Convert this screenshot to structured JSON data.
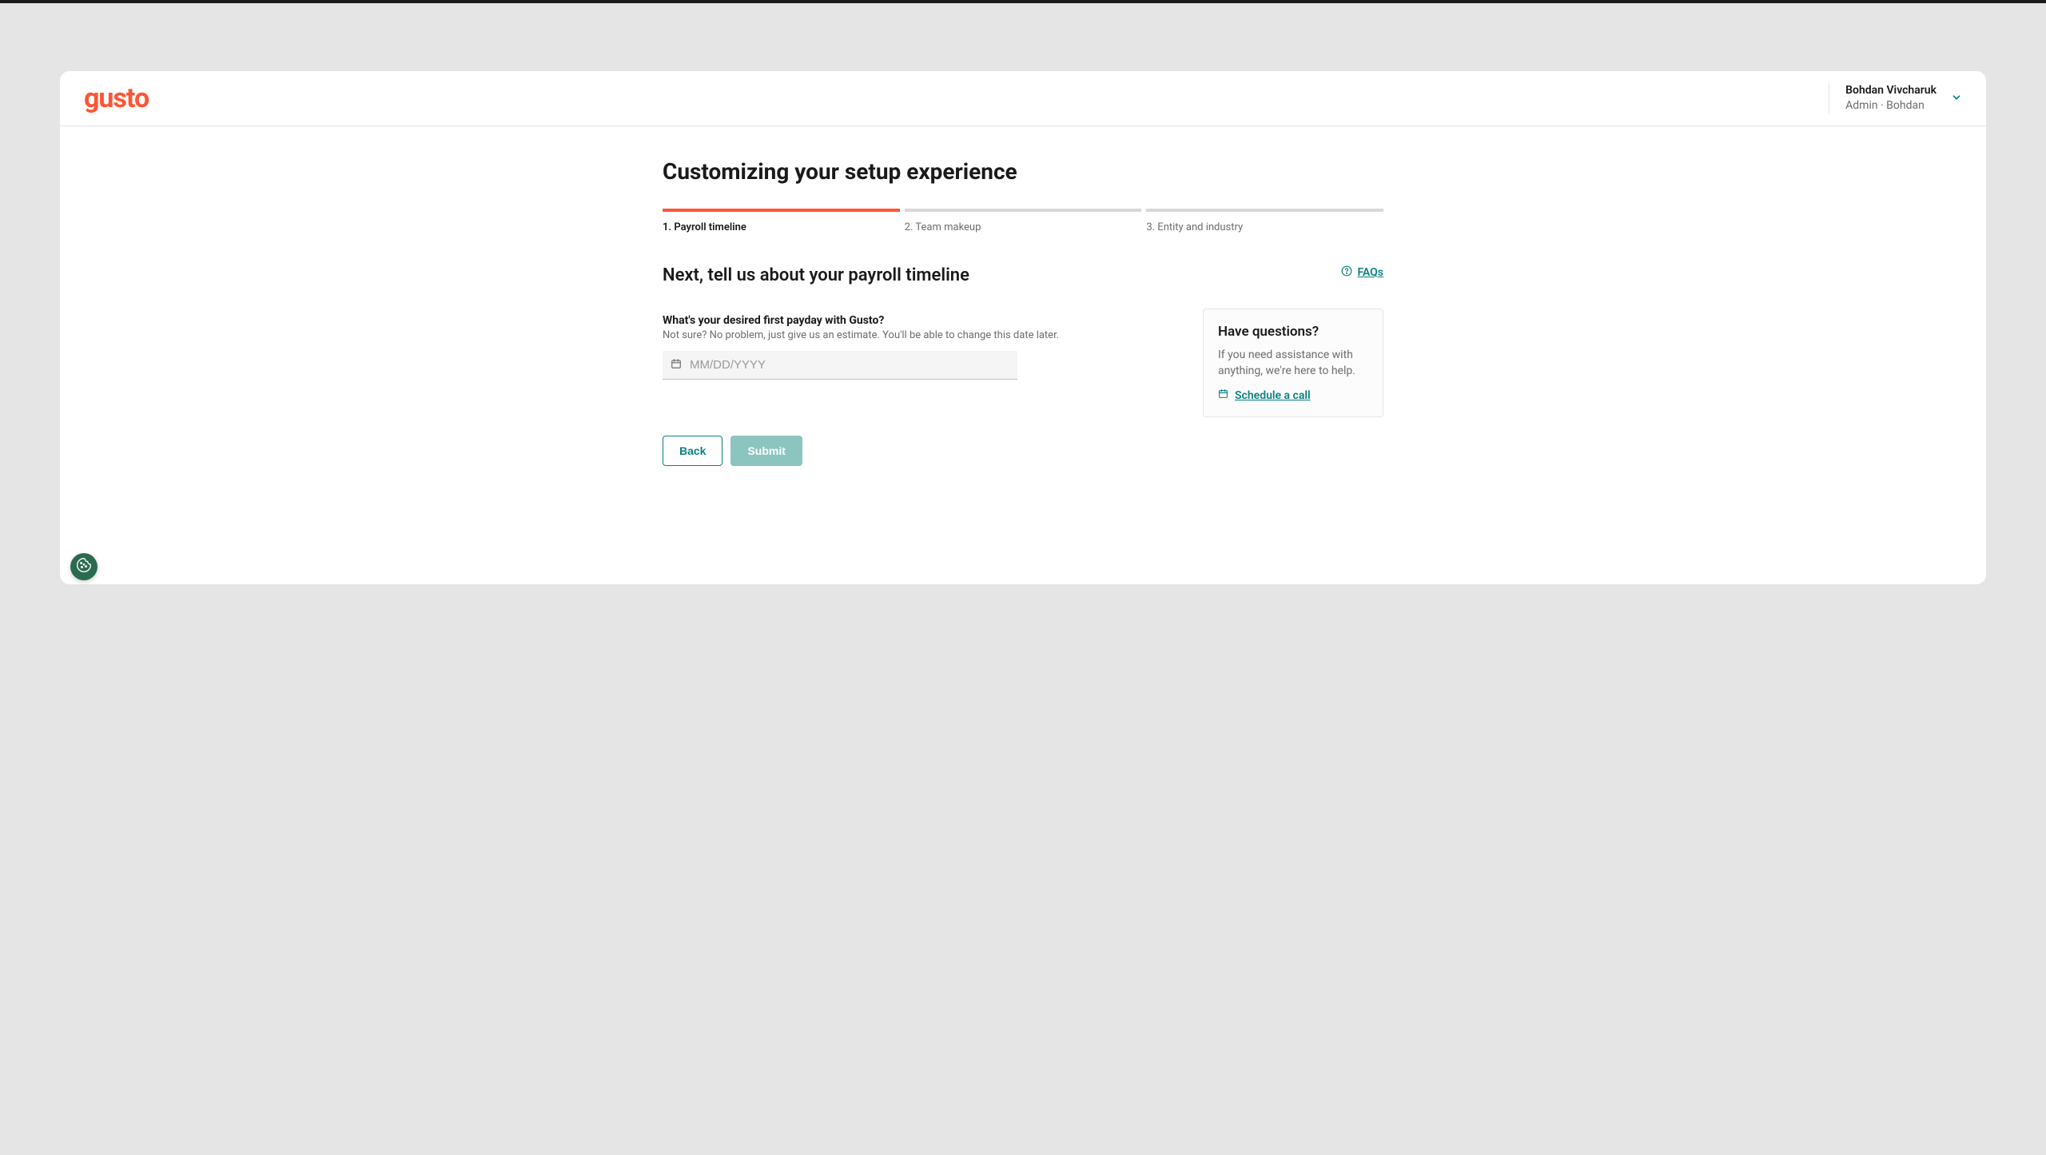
{
  "header": {
    "logo": "gusto",
    "account": {
      "name": "Bohdan Vivcharuk",
      "role": "Admin · Bohdan"
    }
  },
  "page": {
    "title": "Customizing your setup experience",
    "steps": [
      {
        "label": "1. Payroll timeline",
        "active": true
      },
      {
        "label": "2. Team makeup",
        "active": false
      },
      {
        "label": "3. Entity and industry",
        "active": false
      }
    ],
    "subtitle": "Next, tell us about your payroll timeline",
    "field": {
      "label": "What's your desired first payday with Gusto?",
      "hint": "Not sure? No problem, just give us an estimate. You'll be able to change this date later.",
      "placeholder": "MM/DD/YYYY"
    },
    "buttons": {
      "back": "Back",
      "submit": "Submit"
    }
  },
  "side": {
    "faqs": "FAQs",
    "help": {
      "title": "Have questions?",
      "text": "If you need assistance with anything, we're here to help.",
      "cta": "Schedule a call"
    }
  }
}
